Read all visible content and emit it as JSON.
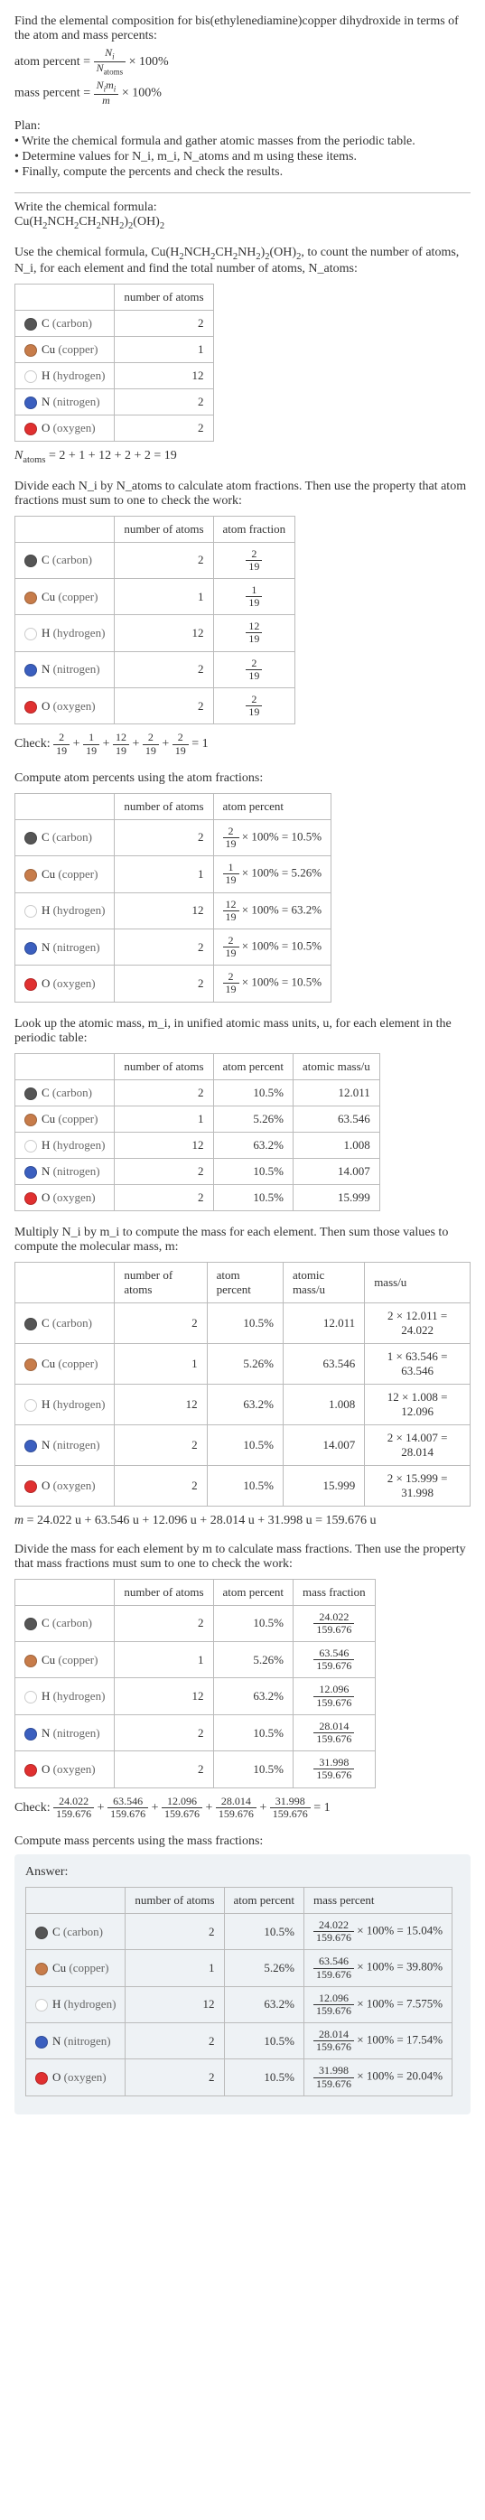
{
  "intro": "Find the elemental composition for bis(ethylenediamine)copper dihydroxide in terms of the atom and mass percents:",
  "eq_atom_percent": "atom percent = N_i / N_atoms × 100%",
  "eq_mass_percent": "mass percent = (N_i m_i) / m × 100%",
  "plan_header": "Plan:",
  "plan_items": [
    "• Write the chemical formula and gather atomic masses from the periodic table.",
    "• Determine values for N_i, m_i, N_atoms and m using these items.",
    "• Finally, compute the percents and check the results."
  ],
  "write_formula_label": "Write the chemical formula:",
  "chem_formula_html": "Cu(H<sub>2</sub>NCH<sub>2</sub>CH<sub>2</sub>NH<sub>2</sub>)<sub>2</sub>(OH)<sub>2</sub>",
  "count_text_a": "Use the chemical formula, ",
  "count_text_b": ", to count the number of atoms, N_i, for each element and find the total number of atoms, N_atoms:",
  "elements": [
    {
      "sym": "C",
      "name": "carbon",
      "color": "#555555",
      "count": 2,
      "af_num": 2,
      "af_den": 19,
      "ap": "10.5%",
      "mass_u": "12.011",
      "mass_calc": "2 × 12.011 = 24.022",
      "mf_num": "24.022",
      "mf_den": "159.676",
      "mp": "15.04%"
    },
    {
      "sym": "Cu",
      "name": "copper",
      "color": "#c77c4a",
      "count": 1,
      "af_num": 1,
      "af_den": 19,
      "ap": "5.26%",
      "mass_u": "63.546",
      "mass_calc": "1 × 63.546 = 63.546",
      "mf_num": "63.546",
      "mf_den": "159.676",
      "mp": "39.80%"
    },
    {
      "sym": "H",
      "name": "hydrogen",
      "color": "#ffffff",
      "count": 12,
      "af_num": 12,
      "af_den": 19,
      "ap": "63.2%",
      "mass_u": "1.008",
      "mass_calc": "12 × 1.008 = 12.096",
      "mf_num": "12.096",
      "mf_den": "159.676",
      "mp": "7.575%"
    },
    {
      "sym": "N",
      "name": "nitrogen",
      "color": "#3b5fbf",
      "count": 2,
      "af_num": 2,
      "af_den": 19,
      "ap": "10.5%",
      "mass_u": "14.007",
      "mass_calc": "2 × 14.007 = 28.014",
      "mf_num": "28.014",
      "mf_den": "159.676",
      "mp": "17.54%"
    },
    {
      "sym": "O",
      "name": "oxygen",
      "color": "#e03030",
      "count": 2,
      "af_num": 2,
      "af_den": 19,
      "ap": "10.5%",
      "mass_u": "15.999",
      "mass_calc": "2 × 15.999 = 31.998",
      "mf_num": "31.998",
      "mf_den": "159.676",
      "mp": "20.04%"
    }
  ],
  "headers": {
    "num_atoms": "number of atoms",
    "atom_fraction": "atom fraction",
    "atom_percent": "atom percent",
    "atomic_mass": "atomic mass/u",
    "mass_u": "mass/u",
    "mass_fraction": "mass fraction",
    "mass_percent": "mass percent"
  },
  "natoms_line": "N_atoms = 2 + 1 + 12 + 2 + 2 = 19",
  "atom_fraction_text": "Divide each N_i by N_atoms to calculate atom fractions. Then use the property that atom fractions must sum to one to check the work:",
  "check_af": "Check: 2/19 + 1/19 + 12/19 + 2/19 + 2/19 = 1",
  "atom_percent_text": "Compute atom percents using the atom fractions:",
  "lookup_mass_text": "Look up the atomic mass, m_i, in unified atomic mass units, u, for each element in the periodic table:",
  "mass_calc_text": "Multiply N_i by m_i to compute the mass for each element. Then sum those values to compute the molecular mass, m:",
  "m_total_line": "m = 24.022 u + 63.546 u + 12.096 u + 28.014 u + 31.998 u = 159.676 u",
  "mass_fraction_text": "Divide the mass for each element by m to calculate mass fractions. Then use the property that mass fractions must sum to one to check the work:",
  "check_mf": "Check: 24.022/159.676 + 63.546/159.676 + 12.096/159.676 + 28.014/159.676 + 31.998/159.676 = 1",
  "mass_percent_text": "Compute mass percents using the mass fractions:",
  "answer_label": "Answer:"
}
